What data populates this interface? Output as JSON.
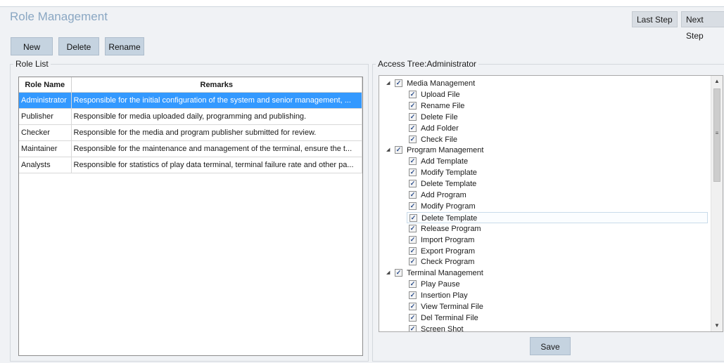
{
  "header": {
    "title": "Role Management",
    "last_step": "Last Step",
    "next_step": "Next Step"
  },
  "toolbar": {
    "new_label": "New",
    "delete_label": "Delete",
    "rename_label": "Rename"
  },
  "role_list": {
    "legend": "Role List",
    "columns": [
      "Role Name",
      "Remarks"
    ],
    "rows": [
      {
        "name": "Administrator",
        "remarks": "Responsible for the initial configuration of the system and senior management, ..."
      },
      {
        "name": "Publisher",
        "remarks": "Responsible for media uploaded daily, programming and publishing."
      },
      {
        "name": "Checker",
        "remarks": "Responsible for the media and program publisher submitted for review."
      },
      {
        "name": "Maintainer",
        "remarks": "Responsible for the maintenance and management of the terminal, ensure the t..."
      },
      {
        "name": "Analysts",
        "remarks": "Responsible for statistics of play data terminal, terminal failure rate and other pa..."
      }
    ],
    "selected_index": 0
  },
  "access_tree": {
    "legend": "Access Tree:Administrator",
    "highlighted": "Delete Template",
    "groups": [
      {
        "label": "Media Management",
        "checked": true,
        "expanded": true,
        "items": [
          "Upload File",
          "Rename File",
          "Delete File",
          "Add Folder",
          "Check File"
        ]
      },
      {
        "label": "Program Management",
        "checked": true,
        "expanded": true,
        "items": [
          "Add Template",
          "Modify Template",
          "Delete Template",
          "Add Program",
          "Modify Program",
          "Delete Template",
          "Release Program",
          "Import Program",
          "Export Program",
          "Check Program"
        ]
      },
      {
        "label": "Terminal Management",
        "checked": true,
        "expanded": true,
        "items": [
          "Play Pause",
          "Insertion Play",
          "View Terminal File",
          "Del Terminal File",
          "Screen Shot"
        ]
      }
    ]
  },
  "save_label": "Save",
  "icons": {
    "checkbox_mark": "✓",
    "expanded_glyph": "◢",
    "scroll_up": "▲",
    "scroll_down": "▼",
    "grip": "≡"
  },
  "colors": {
    "selection": "#3399ff",
    "title": "#8aa7c3",
    "button": "#c5d3e0"
  }
}
